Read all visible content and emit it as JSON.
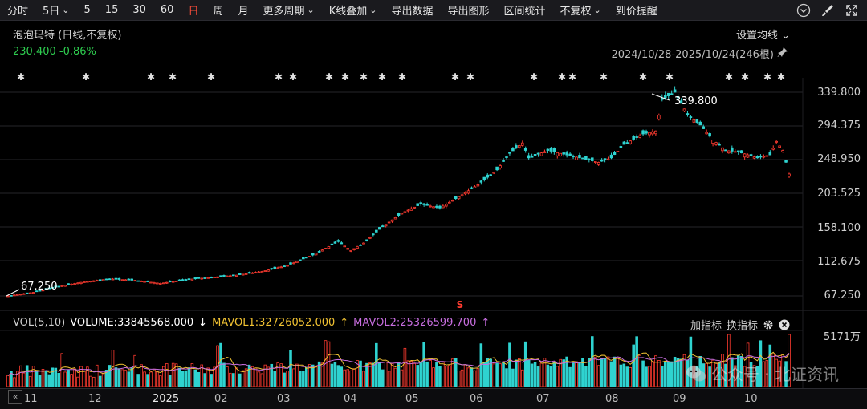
{
  "toolbar": {
    "items": [
      "分时",
      "5日",
      "5",
      "15",
      "30",
      "60",
      "日",
      "周",
      "月",
      "更多周期",
      "K线叠加",
      "导出数据",
      "导出图形",
      "区间统计",
      "不复权",
      "到价提醒"
    ],
    "active": "日",
    "dropdown_markers": [
      "5日",
      "更多周期",
      "K线叠加",
      "不复权"
    ],
    "icons": [
      "chevron-circle-icon",
      "brush-icon",
      "expand-icon"
    ]
  },
  "header": {
    "title": "泡泡玛特 (日线,不复权)",
    "price": "230.400",
    "change": "-0.86%",
    "set_ma": "设置均线",
    "range": "2024/10/28-2025/10/24(246根)"
  },
  "price_axis": [
    "339.800",
    "294.375",
    "248.950",
    "203.525",
    "158.100",
    "112.675",
    "67.250"
  ],
  "high_label": "339.800",
  "low_label": "67.250",
  "volume": {
    "name": "VOL(5,10)",
    "volume": "VOLUME:33845568.000",
    "mavol1": "MAVOL1:32726052.000",
    "mavol2": "MAVOL2:25326599.700",
    "tools_add": "加指标",
    "tools_swap": "换指标",
    "axis_label": "5171万"
  },
  "x_axis": [
    "11",
    "12",
    "2025",
    "02",
    "03",
    "04",
    "05",
    "06",
    "07",
    "08",
    "09",
    "10"
  ],
  "event_marker": "S",
  "watermark": "公众号 · 北证资讯",
  "colors": {
    "up": "#ff3b30",
    "down": "#2fd3d0",
    "ma1": "#f1c232",
    "ma2": "#c86ee0",
    "active": "#ff4d3b",
    "green_text": "#2ecc4f"
  },
  "chart_data": {
    "type": "candlestick",
    "y_range": [
      67.25,
      339.8
    ],
    "y_ticks": [
      339.8,
      294.375,
      248.95,
      203.525,
      158.1,
      112.675,
      67.25
    ],
    "close_path": [
      [
        0,
        67.3
      ],
      [
        8,
        72
      ],
      [
        16,
        80
      ],
      [
        24,
        86
      ],
      [
        32,
        90
      ],
      [
        40,
        88
      ],
      [
        48,
        84
      ],
      [
        56,
        89
      ],
      [
        64,
        92
      ],
      [
        72,
        95
      ],
      [
        80,
        100
      ],
      [
        88,
        108
      ],
      [
        96,
        122
      ],
      [
        104,
        140
      ],
      [
        108,
        128
      ],
      [
        112,
        138
      ],
      [
        118,
        160
      ],
      [
        124,
        178
      ],
      [
        130,
        190
      ],
      [
        136,
        185
      ],
      [
        142,
        200
      ],
      [
        148,
        216
      ],
      [
        154,
        236
      ],
      [
        158,
        258
      ],
      [
        162,
        272
      ],
      [
        164,
        252
      ],
      [
        170,
        262
      ],
      [
        176,
        256
      ],
      [
        182,
        250
      ],
      [
        186,
        246
      ],
      [
        190,
        252
      ],
      [
        194,
        270
      ],
      [
        200,
        284
      ],
      [
        204,
        288
      ],
      [
        206,
        330
      ],
      [
        210,
        339.8
      ],
      [
        214,
        310
      ],
      [
        218,
        296
      ],
      [
        222,
        276
      ],
      [
        226,
        262
      ],
      [
        230,
        260
      ],
      [
        236,
        252
      ],
      [
        240,
        256
      ],
      [
        242,
        274
      ],
      [
        244,
        262
      ],
      [
        246,
        230.4
      ]
    ]
  }
}
